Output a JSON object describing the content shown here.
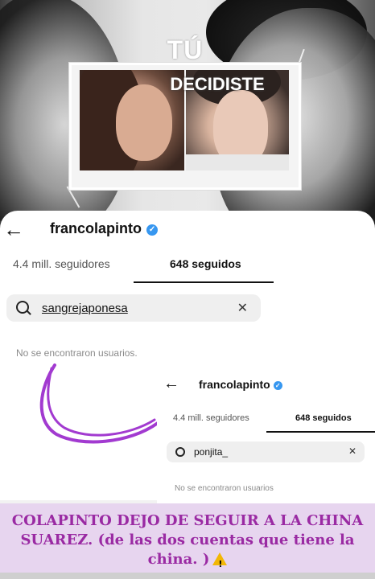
{
  "story_image": {
    "overlay_title_line1": "TÚ",
    "overlay_title_line2": "DECIDISTE"
  },
  "profile_screenshot": {
    "back_icon": "arrow-left-icon",
    "username": "francolapinto",
    "verified_icon": "verified-badge-icon",
    "tabs": [
      {
        "label": "4.4 mill. seguidores",
        "active": false
      },
      {
        "label": "648 seguidos",
        "active": true
      }
    ],
    "search": {
      "icon": "search-icon",
      "value": "sangrejaponesa",
      "clear_icon": "close-icon"
    },
    "empty_message": "No se encontraron usuarios."
  },
  "inset_screenshot": {
    "username": "francolapinto",
    "tabs": [
      {
        "label": "4.4 mill. seguidores",
        "active": false
      },
      {
        "label": "648 seguidos",
        "active": true
      }
    ],
    "search_value": "ponjita_",
    "empty_message": "No se encontraron usuarios"
  },
  "caption": {
    "text": "COLAPINTO DEJO DE SEGUIR A LA CHINA SUAREZ. (de las dos cuentas que tiene la china. )",
    "emoji": "warning-icon",
    "color": "#9a2aa3"
  },
  "colors": {
    "verified": "#3797f0",
    "caption_bg": "#e7d5ef",
    "swoosh": "#a23ad0"
  }
}
